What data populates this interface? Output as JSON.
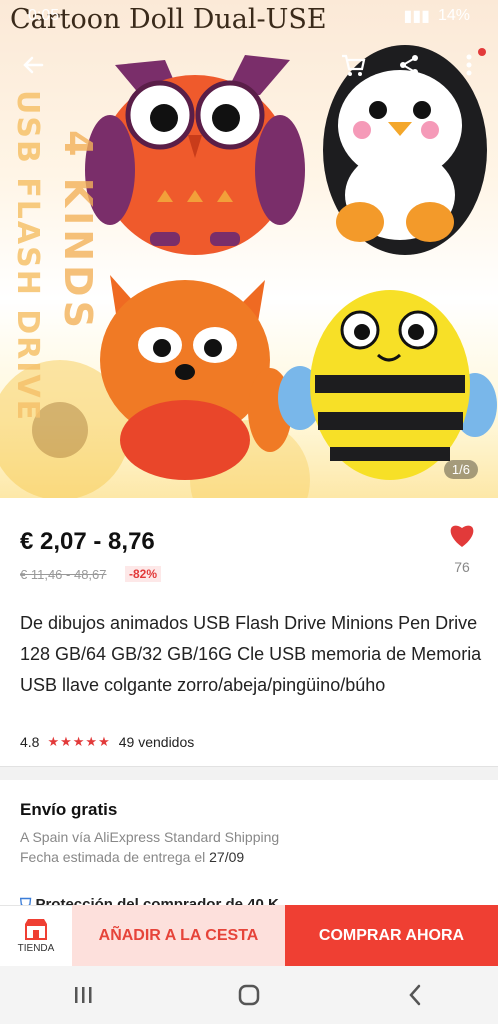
{
  "statusbar": {
    "time": "0:05",
    "battery": "14%"
  },
  "hero": {
    "watermark_title": "Cartoon Doll Dual-USE",
    "side_text_a": "USB FLASH DRIVE",
    "side_text_b": "4 KINDS",
    "image_counter": "1/6"
  },
  "product": {
    "price": "€ 2,07 - 8,76",
    "old_price": "€ 11,46 - 48,67",
    "discount": "-82%",
    "wishlist_count": "76",
    "title": "De dibujos animados USB Flash Drive Minions Pen Drive 128 GB/64 GB/32 GB/16G Cle USB memoria de Memoria USB llave colgante zorro/abeja/pingüino/búho",
    "rating": "4.8",
    "stars": "★★★★★",
    "sold": "49 vendidos"
  },
  "shipping": {
    "title": "Envío gratis",
    "method": "A Spain vía AliExpress Standard Shipping",
    "date_label": "Fecha estimada de entrega el",
    "date": "27/09",
    "protection_partial": "Protección del comprador de 40 K..."
  },
  "bottom": {
    "store_label": "TIENDA",
    "add_to_cart": "AÑADIR A LA CESTA",
    "buy_now": "COMPRAR AHORA"
  },
  "colors": {
    "accent": "#ef3f33",
    "cart_bg": "#fde0dc",
    "heart": "#e23a3a"
  }
}
